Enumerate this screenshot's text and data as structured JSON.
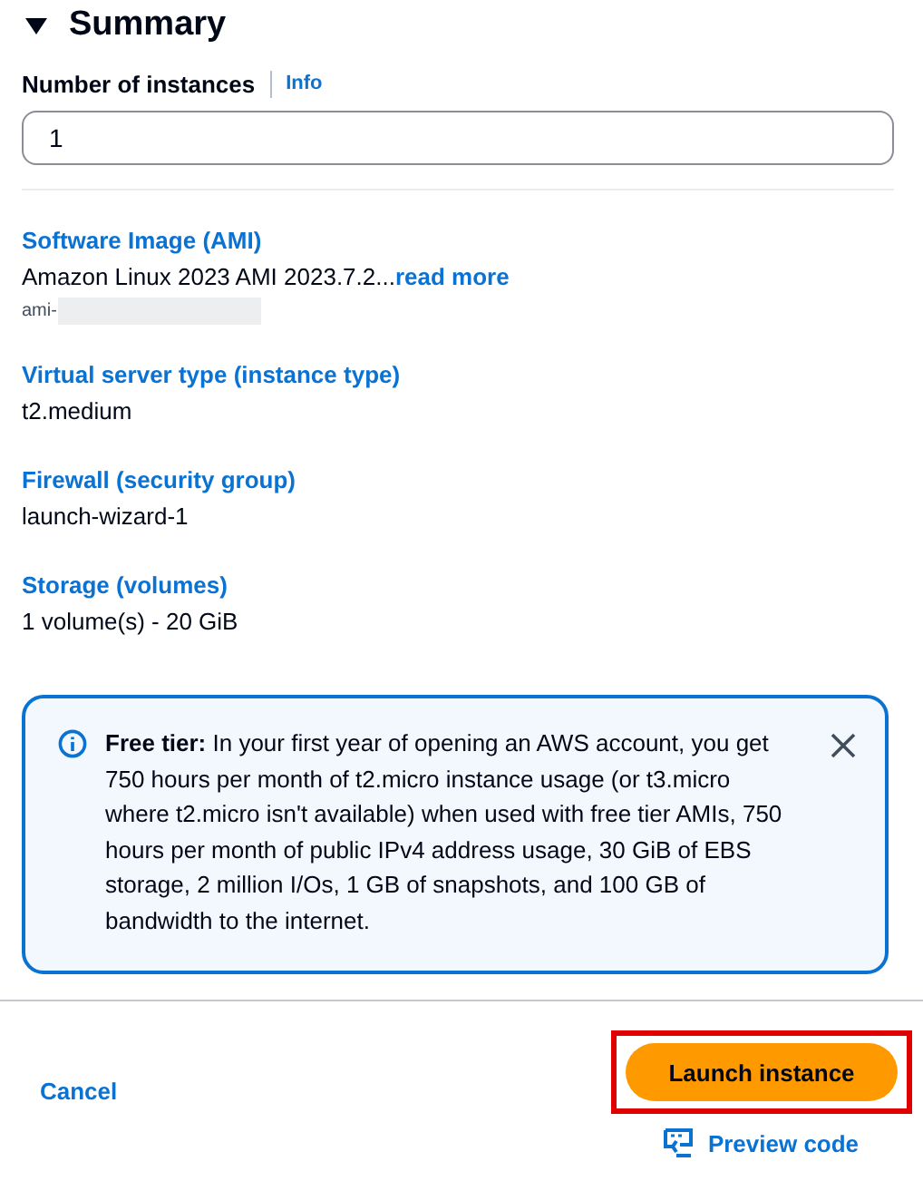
{
  "summary": {
    "title": "Summary",
    "expanded": true
  },
  "instances": {
    "label": "Number of instances",
    "info": "Info",
    "value": "1"
  },
  "sections": [
    {
      "title": "Software Image (AMI)",
      "value": "Amazon Linux 2023 AMI 2023.7.2...",
      "link": "read more",
      "sub": "ami-"
    },
    {
      "title": "Virtual server type (instance type)",
      "value": "t2.medium"
    },
    {
      "title": "Firewall (security group)",
      "value": "launch-wizard-1"
    },
    {
      "title": "Storage (volumes)",
      "value": "1 volume(s) - 20 GiB"
    }
  ],
  "alert": {
    "text": "**Free tier:** In your first year of opening an AWS account, you get 750 hours per month of t2.micro instance usage (or t3.micro where t2.micro isn't available) when used with free tier AMIs, 750 hours per month of public IPv4 address usage, 30 GiB of EBS storage, 2 million I/Os, 1 GB of snapshots, and 100 GB of bandwidth to the internet."
  },
  "footer": {
    "cancel": "Cancel",
    "launch": "Launch instance",
    "launch_highlighted": true,
    "preview": "Preview code"
  }
}
